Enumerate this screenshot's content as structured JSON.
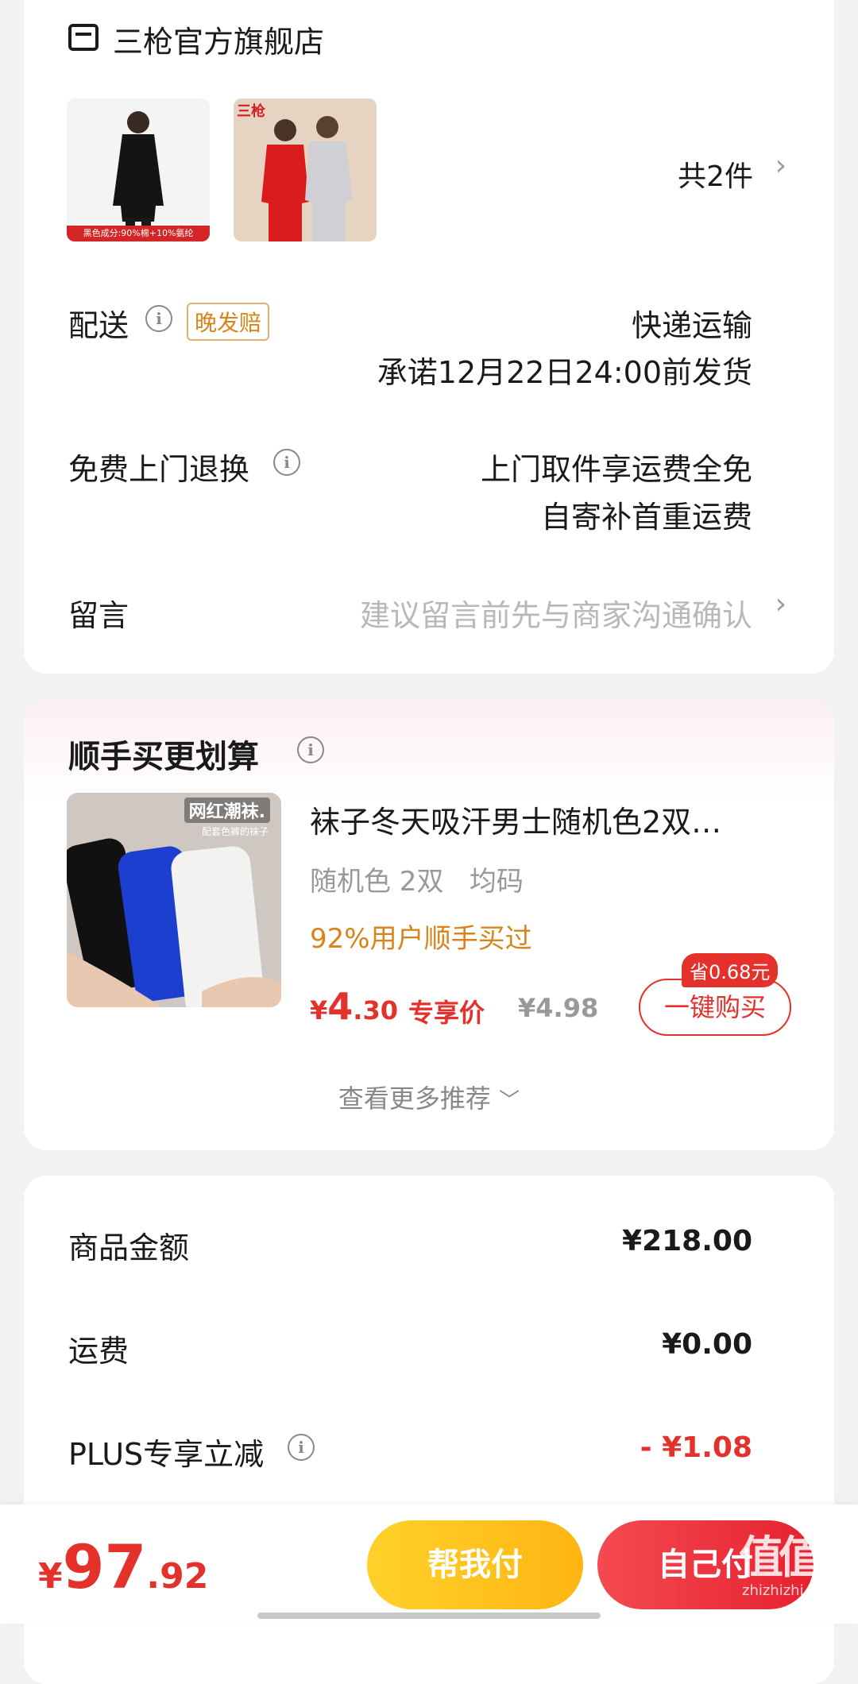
{
  "store": {
    "name": "三枪官方旗舰店",
    "icon": "store-icon"
  },
  "products": {
    "count_label": "共2件",
    "item1_caption": "黑色成分:90%棉+10%氨纶",
    "item2_brand": "三枪"
  },
  "delivery": {
    "label": "配送",
    "badge": "晚发赔",
    "method": "快递运输",
    "promise": "承诺12月22日24:00前发货"
  },
  "returns": {
    "label": "免费上门退换",
    "line1": "上门取件享运费全免",
    "line2": "自寄补首重运费"
  },
  "message": {
    "label": "留言",
    "placeholder": "建议留言前先与商家沟通确认"
  },
  "addon": {
    "title": "顺手买更划算",
    "product_title": "袜子冬天吸汗男士随机色2双…",
    "spec": "随机色 2双   均码",
    "social_proof": "92%用户顺手买过",
    "price_symbol": "¥",
    "price_int": "4",
    "price_dec": ".30",
    "price_tag": "专享价",
    "original_price": "¥4.98",
    "save_badge": "省0.68元",
    "buy_button": "一键购买",
    "img_tag": "网红潮袜.",
    "img_sub": "配套色裤的袜子",
    "more": "查看更多推荐"
  },
  "summary": {
    "goods_label": "商品金额",
    "goods_value": "¥218.00",
    "shipping_label": "运费",
    "shipping_value": "¥0.00",
    "plus_label": "PLUS专享立减",
    "plus_value": "- ¥1.08"
  },
  "footer": {
    "currency": "¥",
    "total_int": "97",
    "total_dec": ".92",
    "help_pay": "帮我付",
    "self_pay": "自己付",
    "watermark": "值",
    "watermark_url": "zhizhizhi.com"
  },
  "colors": {
    "accent_red": "#e4312b",
    "orange": "#d9841a",
    "yellow": "#ffc21a"
  }
}
